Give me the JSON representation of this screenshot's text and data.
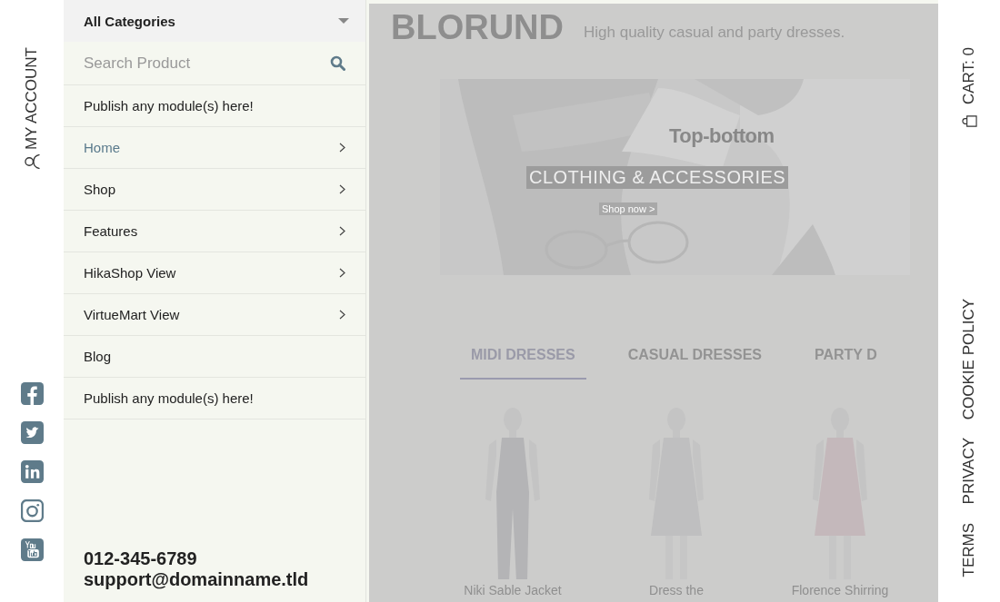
{
  "left_rail": {
    "account_label": "MY ACCOUNT",
    "social": [
      {
        "kind": "facebook"
      },
      {
        "kind": "twitter"
      },
      {
        "kind": "linkedin"
      },
      {
        "kind": "instagram"
      },
      {
        "kind": "youtube"
      }
    ]
  },
  "menu": {
    "category_select": "All Categories",
    "search": {
      "placeholder": "Search Product"
    },
    "items": [
      {
        "label": "Publish any module(s) here!",
        "selected": false,
        "has_submenu": false
      },
      {
        "label": "Home",
        "selected": true,
        "has_submenu": true
      },
      {
        "label": "Shop",
        "selected": false,
        "has_submenu": true
      },
      {
        "label": "Features",
        "selected": false,
        "has_submenu": true
      },
      {
        "label": "HikaShop View",
        "selected": false,
        "has_submenu": true
      },
      {
        "label": "VirtueMart View",
        "selected": false,
        "has_submenu": true
      },
      {
        "label": "Blog",
        "selected": false,
        "has_submenu": false
      },
      {
        "label": "Publish any module(s) here!",
        "selected": false,
        "has_submenu": false
      }
    ],
    "contact": {
      "phone": "012-345-6789",
      "email": "support@domainname.tld"
    }
  },
  "content": {
    "logo": "BLORUND",
    "tagline": "High quality casual and party dresses.",
    "banner": {
      "kind": "picture",
      "title": "Top-bottom",
      "subtitle": "CLOTHING & ACCESSORIES",
      "link": "Shop now >"
    },
    "tabs": [
      {
        "label": "MIDI DRESSES",
        "selected": true
      },
      {
        "label": "CASUAL DRESSES",
        "selected": false
      },
      {
        "label": "PARTY D",
        "selected": false
      }
    ],
    "products": [
      {
        "kind": "picture",
        "name": "Niki Sable Jacket"
      },
      {
        "kind": "picture",
        "name": "Dress the"
      },
      {
        "kind": "picture",
        "name": "Florence Shirring"
      }
    ]
  },
  "right_rail": {
    "cart": "CART: 0",
    "links": [
      "COOKIE POLICY",
      "PRIVACY",
      "TERMS"
    ]
  }
}
